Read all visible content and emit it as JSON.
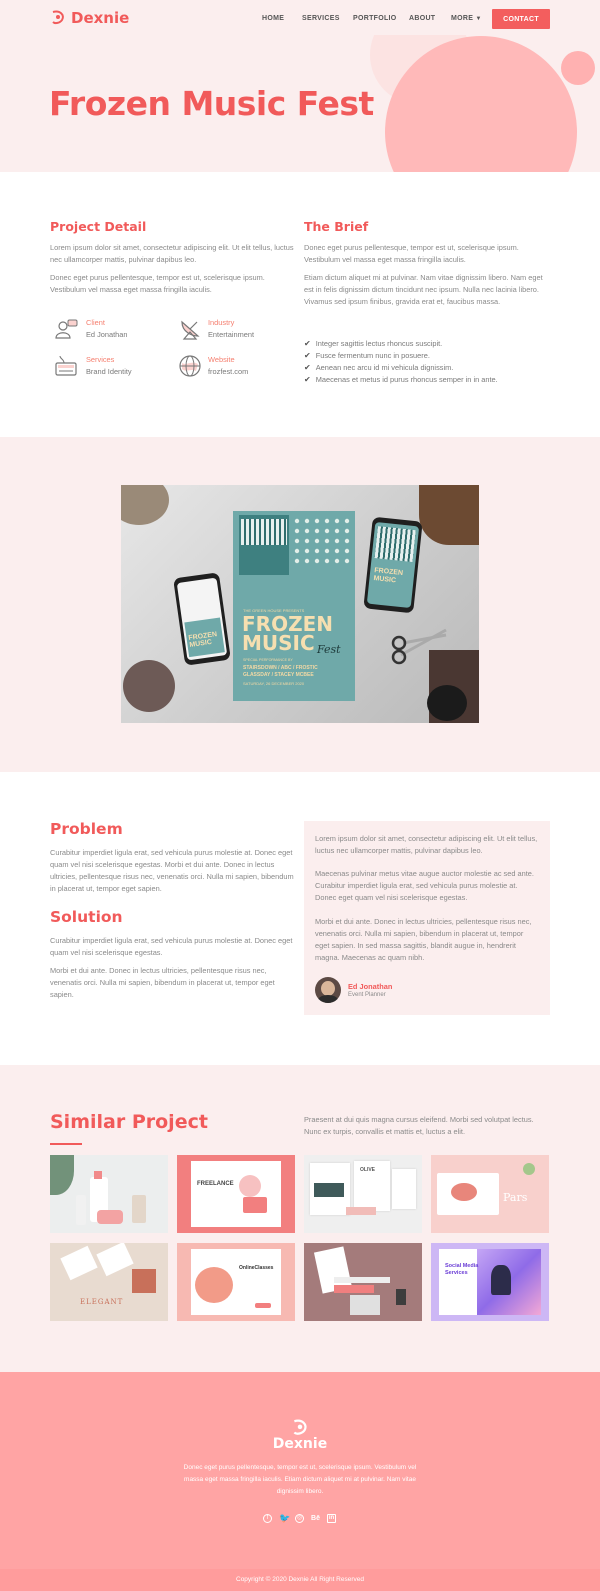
{
  "brand": {
    "name": "Dexnie",
    "accent": "#f15a5a",
    "light_bg": "#fbeeee",
    "footer_bg": "#ffa4a4"
  },
  "nav": {
    "items": [
      "HOME",
      "SERVICES",
      "PORTFOLIO",
      "ABOUT",
      "MORE"
    ],
    "contact": "CONTACT"
  },
  "hero": {
    "title": "Frozen Music Fest"
  },
  "project_detail": {
    "title": "Project Detail",
    "para1": "Lorem ipsum dolor sit amet, consectetur adipiscing elit. Ut elit tellus, luctus nec ullamcorper mattis, pulvinar dapibus leo.",
    "para2": "Donec eget purus pellentesque, tempor est ut, scelerisque ipsum. Vestibulum vel massa eget massa fringilla iaculis.",
    "meta": [
      {
        "label": "Client",
        "value": "Ed Jonathan",
        "icon": "client-icon"
      },
      {
        "label": "Industry",
        "value": "Entertainment",
        "icon": "satellite-dish-icon"
      },
      {
        "label": "Services",
        "value": "Brand Identity",
        "icon": "keyboard-icon"
      },
      {
        "label": "Website",
        "value": "frozfest.com",
        "icon": "globe-icon"
      }
    ]
  },
  "brief": {
    "title": "The Brief",
    "para1": "Donec eget purus pellentesque, tempor est ut, scelerisque ipsum. Vestibulum vel massa eget massa fringilla iaculis.",
    "para2": "Etiam dictum aliquet mi at pulvinar. Nam vitae dignissim libero. Nam eget est in felis dignissim dictum tincidunt nec ipsum. Nulla nec lacinia libero. Vivamus sed ipsum finibus, gravida erat et, faucibus massa.",
    "checks": [
      "Integer sagittis lectus rhoncus suscipit.",
      "Fusce fermentum nunc in posuere.",
      "Aenean nec arcu id mi vehicula dignissim.",
      "Maecenas et metus id purus rhoncus semper in in ante."
    ]
  },
  "poster": {
    "small_top": "THE GREEN HOUSE PRESENTS",
    "line1": "FROZEN",
    "line2": "MUSIC",
    "script": "Fest",
    "special": "SPECIAL PERFORMANCE BY",
    "bands1": "STAIRSDOWN / ABC / FROSTIC",
    "bands2": "GLASSDAY / STACEY MCBEE",
    "date": "SATURDAY, 26 DECEMBER 2020",
    "phone1": "FROZEN",
    "phone2": "MUSIC"
  },
  "problem": {
    "title": "Problem",
    "para": "Curabitur imperdiet ligula erat, sed vehicula purus molestie at. Donec eget quam vel nisi scelerisque egestas. Morbi et dui ante. Donec in lectus ultricies, pellentesque risus nec, venenatis orci. Nulla mi sapien, bibendum in placerat ut, tempor eget sapien."
  },
  "solution": {
    "title": "Solution",
    "para1": "Curabitur imperdiet ligula erat, sed vehicula purus molestie at. Donec eget quam vel nisi scelerisque egestas.",
    "para2": "Morbi et dui ante. Donec in lectus ultricies, pellentesque risus nec, venenatis orci. Nulla mi sapien, bibendum in placerat ut, tempor eget sapien."
  },
  "testimonial": {
    "para1": "Lorem ipsum dolor sit amet, consectetur adipiscing elit. Ut elit tellus, luctus nec ullamcorper mattis, pulvinar dapibus leo.",
    "para2": "Maecenas pulvinar metus vitae augue auctor molestie ac sed ante. Curabitur imperdiet ligula erat, sed vehicula purus molestie at. Donec eget quam vel nisi scelerisque egestas.",
    "para3": "Morbi et dui ante. Donec in lectus ultricies, pellentesque risus nec, venenatis orci. Nulla mi sapien, bibendum in placerat ut, tempor eget sapien. In sed massa sagittis, blandit augue in, hendrerit magna. Maecenas ac quam nibh.",
    "name": "Ed Jonathan",
    "role": "Event Planner"
  },
  "similar": {
    "title": "Similar Project",
    "desc": "Praesent at dui quis magna cursus eleifend. Morbi sed volutpat lectus. Nunc ex turpis, convallis et mattis et, luctus a elit.",
    "thumbs": [
      {
        "caption": "",
        "bg": "#e9eceb"
      },
      {
        "caption": "FREELANCE",
        "bg": "#f27f7f"
      },
      {
        "caption": "OLIVE",
        "bg": "#eeeeee"
      },
      {
        "caption": "Pars",
        "bg": "#f6c9c5"
      },
      {
        "caption": "ELEGANT",
        "bg": "#e9dcd1"
      },
      {
        "caption": "OnlineClasses",
        "bg": "#f7b8b0"
      },
      {
        "caption": "",
        "bg": "#a47b7b"
      },
      {
        "caption": "Social Media Services",
        "bg": "#cdb7f7"
      }
    ]
  },
  "footer": {
    "brand": "Dexnie",
    "text": "Donec eget purus pellentesque, tempor est ut, scelerisque ipsum. Vestibulum vel massa eget massa fringilla iaculis. Etiam dictum aliquet mi at pulvinar. Nam vitae dignissim libero.",
    "socials": [
      "facebook-icon",
      "twitter-icon",
      "dribbble-icon",
      "behance-icon",
      "linkedin-icon"
    ],
    "copyright": "Copyright © 2020 Dexnie All Right Reserved"
  }
}
